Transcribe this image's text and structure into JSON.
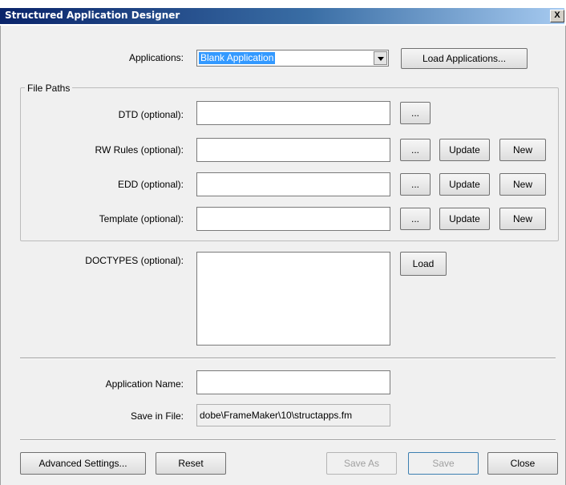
{
  "window": {
    "title": "Structured Application Designer",
    "close_label": "X"
  },
  "applications": {
    "label": "Applications:",
    "selected": "Blank Application",
    "load_button": "Load Applications..."
  },
  "file_paths": {
    "legend": "File Paths",
    "dtd": {
      "label": "DTD (optional):",
      "value": "",
      "browse": "..."
    },
    "rw_rules": {
      "label": "RW Rules (optional):",
      "value": "",
      "browse": "...",
      "update": "Update",
      "new": "New"
    },
    "edd": {
      "label": "EDD (optional):",
      "value": "",
      "browse": "...",
      "update": "Update",
      "new": "New"
    },
    "template": {
      "label": "Template (optional):",
      "value": "",
      "browse": "...",
      "update": "Update",
      "new": "New"
    }
  },
  "doctypes": {
    "label": "DOCTYPES (optional):",
    "load_button": "Load"
  },
  "application_name": {
    "label": "Application Name:",
    "value": ""
  },
  "save_in_file": {
    "label": "Save in File:",
    "value": "dobe\\FrameMaker\\10\\structapps.fm"
  },
  "footer": {
    "advanced": "Advanced Settings...",
    "reset": "Reset",
    "save_as": "Save As",
    "save": "Save",
    "close": "Close"
  }
}
